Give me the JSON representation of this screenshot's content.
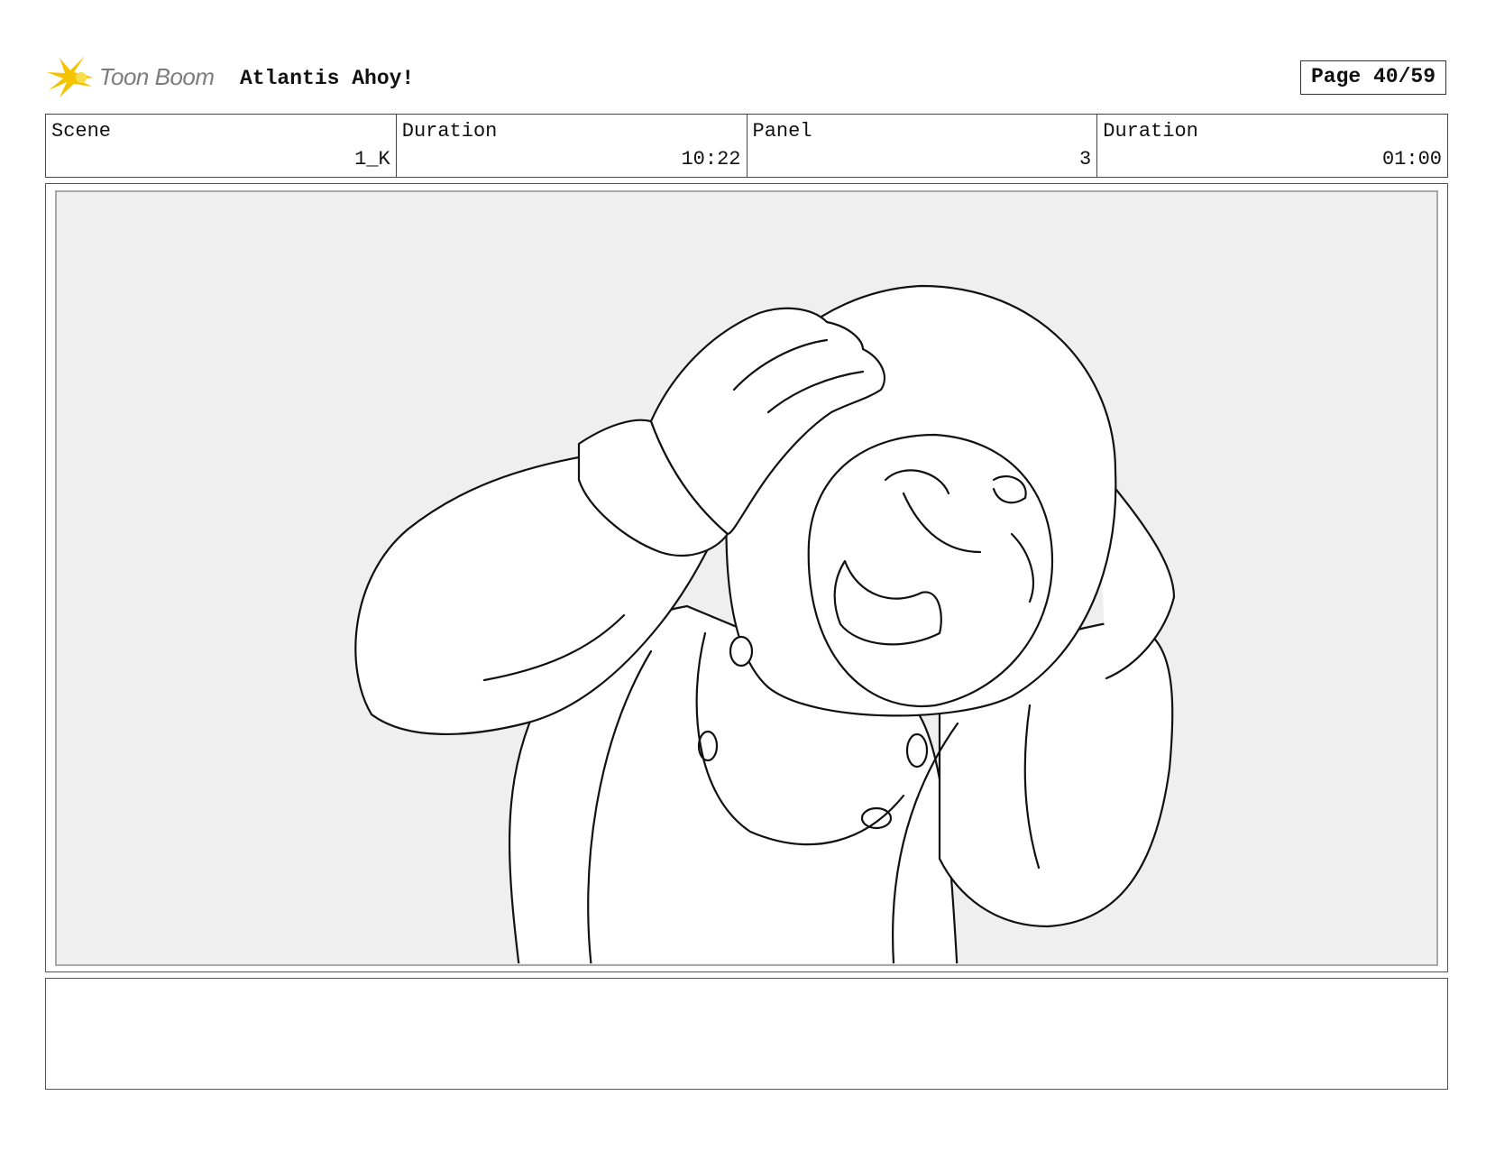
{
  "header": {
    "logo_text": "Toon Boom",
    "project_title": "Atlantis Ahoy!",
    "page_label": "Page 40/59"
  },
  "info": {
    "scene_label": "Scene",
    "scene_value": "1_K",
    "scene_duration_label": "Duration",
    "scene_duration_value": "10:22",
    "panel_label": "Panel",
    "panel_value": "3",
    "panel_duration_label": "Duration",
    "panel_duration_value": "01:00"
  },
  "notes": {
    "text": ""
  },
  "colors": {
    "logo_star": "#f5c400",
    "logo_text": "#7d7d7d",
    "panel_bg": "#efefef"
  }
}
